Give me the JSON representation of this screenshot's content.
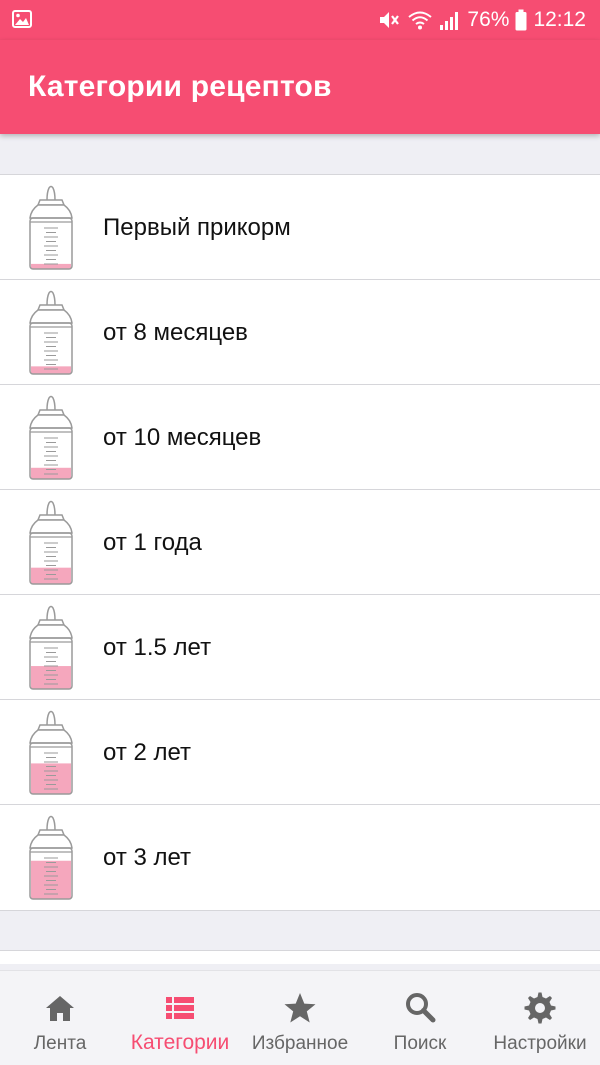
{
  "status_bar": {
    "battery": "76%",
    "time": "12:12",
    "icons": [
      "gallery-icon",
      "mute-icon",
      "wifi-icon",
      "signal-icon",
      "battery-icon"
    ]
  },
  "app_bar": {
    "title": "Категории рецептов"
  },
  "colors": {
    "accent": "#f64d72",
    "bottle_fill": "#f5a7bd",
    "background": "#efeff4"
  },
  "categories": [
    {
      "label": "Первый прикорм",
      "fill_level": 0.1
    },
    {
      "label": "от 8 месяцев",
      "fill_level": 0.15
    },
    {
      "label": "от 10 месяцев",
      "fill_level": 0.22
    },
    {
      "label": "от 1 года",
      "fill_level": 0.32
    },
    {
      "label": "от 1.5 лет",
      "fill_level": 0.45
    },
    {
      "label": "от 2 лет",
      "fill_level": 0.6
    },
    {
      "label": "от 3 лет",
      "fill_level": 0.75
    }
  ],
  "bottom_nav": [
    {
      "label": "Лента",
      "icon": "home-icon",
      "active": false
    },
    {
      "label": "Категории",
      "icon": "list-icon",
      "active": true
    },
    {
      "label": "Избранное",
      "icon": "star-icon",
      "active": false
    },
    {
      "label": "Поиск",
      "icon": "search-icon",
      "active": false
    },
    {
      "label": "Настройки",
      "icon": "gear-icon",
      "active": false
    }
  ]
}
